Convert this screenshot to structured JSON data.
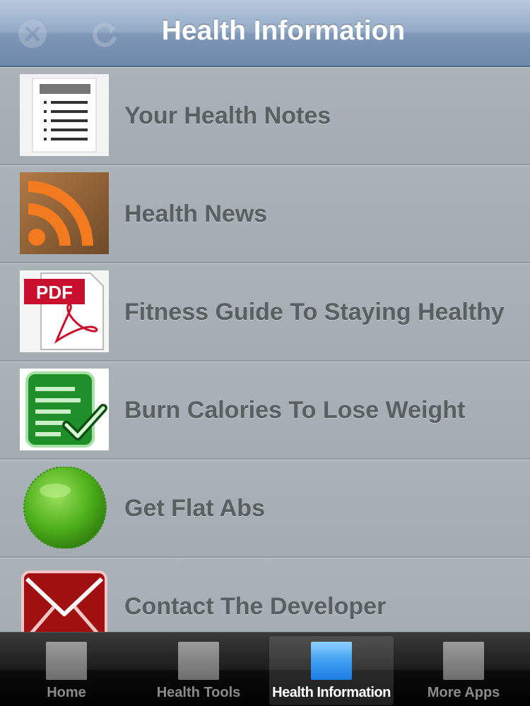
{
  "header": {
    "title": "Health Information",
    "left_icons": [
      "close-icon",
      "refresh-icon"
    ]
  },
  "list": {
    "items": [
      {
        "label": "Your Health Notes",
        "icon": "notes-document-icon"
      },
      {
        "label": "Health News",
        "icon": "rss-feed-icon"
      },
      {
        "label": "Fitness Guide To Staying Healthy",
        "icon": "pdf-document-icon",
        "icon_text": "PDF"
      },
      {
        "label": "Burn Calories To Lose Weight",
        "icon": "checklist-icon"
      },
      {
        "label": "Get Flat Abs",
        "icon": "green-ball-icon"
      },
      {
        "label": "Contact The Developer",
        "icon": "mail-envelope-icon"
      }
    ]
  },
  "tabbar": {
    "tabs": [
      {
        "label": "Home",
        "active": false
      },
      {
        "label": "Health Tools",
        "active": false
      },
      {
        "label": "Health Information",
        "active": true
      },
      {
        "label": "More Apps",
        "active": false
      }
    ]
  },
  "colors": {
    "header_bg": "#8ba2c0",
    "list_bg": "#a9b2b6",
    "label_text": "#5a5f62",
    "tab_active": "#2f8fe8",
    "rss_orange": "#f47a1f",
    "pdf_red": "#c8102e",
    "check_green": "#1f8f2a",
    "ball_green": "#4caf1a",
    "mail_red": "#a01010"
  }
}
